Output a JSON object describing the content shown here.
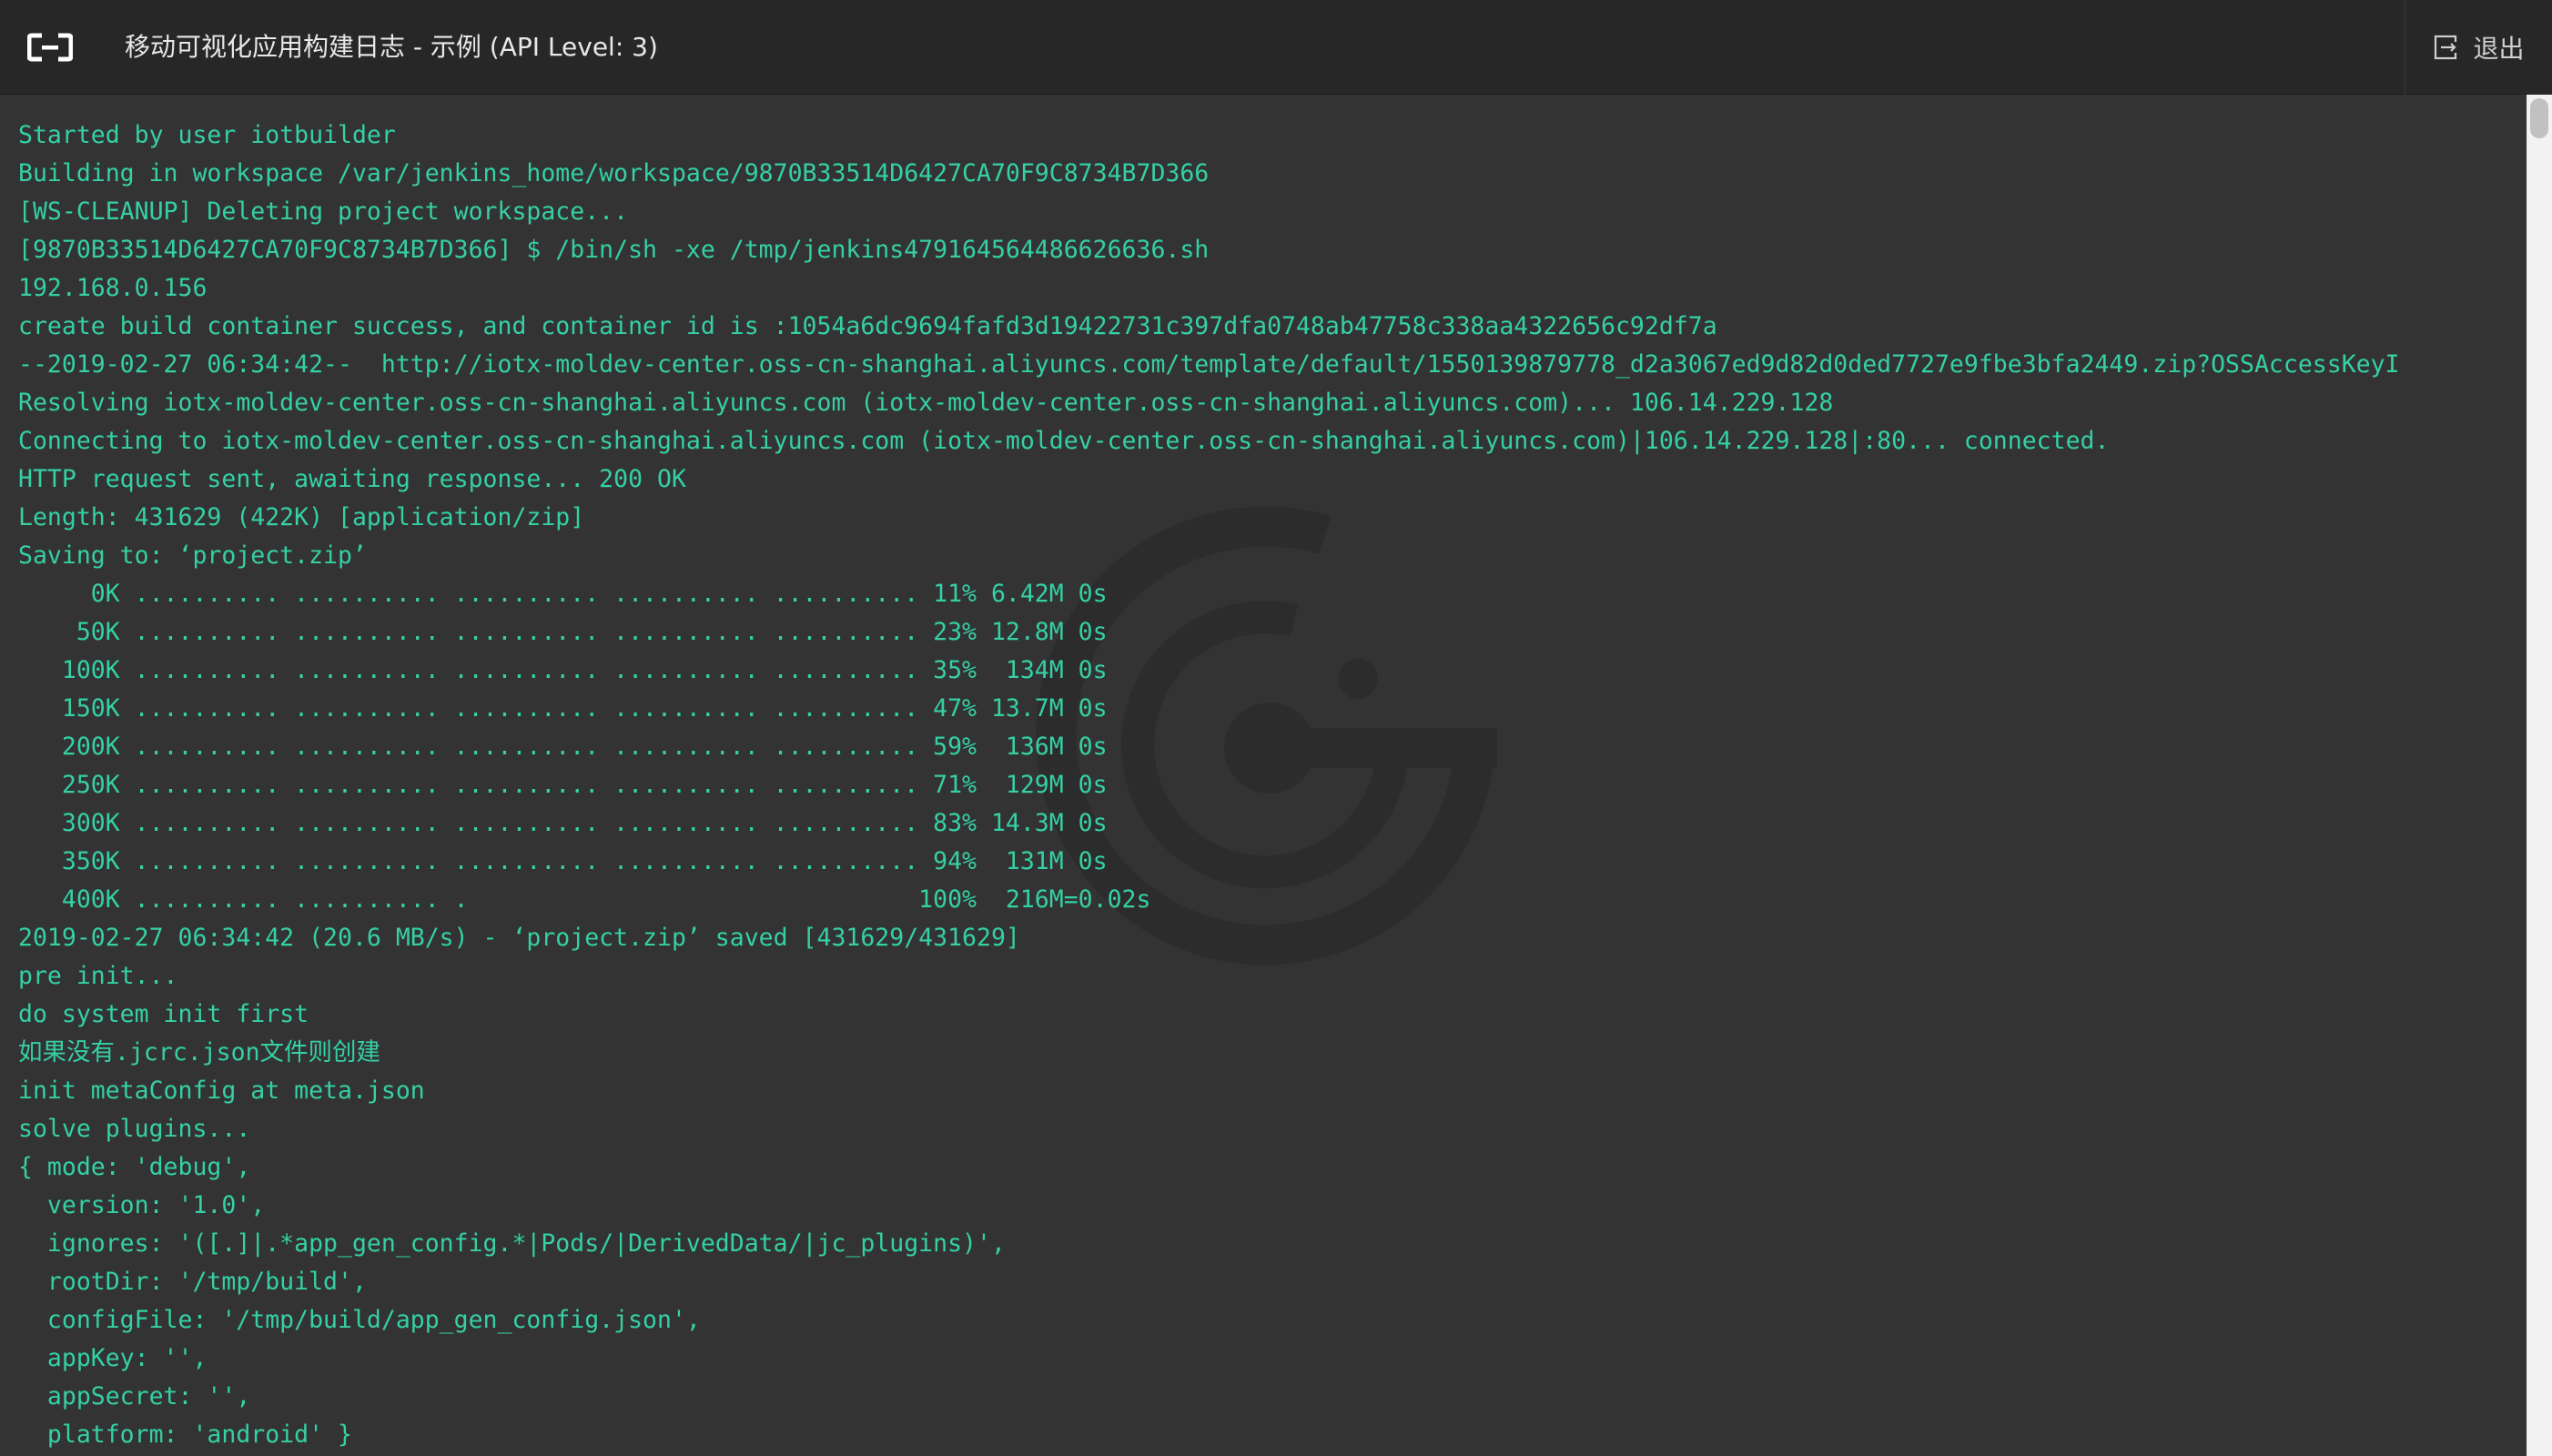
{
  "header": {
    "title": "移动可视化应用构建日志 - 示例 (API Level: 3)",
    "logo_icon": "aliyun-logo-icon",
    "exit_icon": "exit-icon",
    "exit_label": "退出"
  },
  "colors": {
    "header_bg": "#272727",
    "console_bg": "#333333",
    "log_text": "#35d0a4",
    "title_text": "#e8e8e8"
  },
  "watermark_icon": "g-logo-watermark-icon",
  "log_lines": [
    "Started by user iotbuilder",
    "Building in workspace /var/jenkins_home/workspace/9870B33514D6427CA70F9C8734B7D366",
    "[WS-CLEANUP] Deleting project workspace...",
    "[9870B33514D6427CA70F9C8734B7D366] $ /bin/sh -xe /tmp/jenkins479164564486626636.sh",
    "192.168.0.156",
    "create build container success, and container id is :1054a6dc9694fafd3d19422731c397dfa0748ab47758c338aa4322656c92df7a",
    "--2019-02-27 06:34:42--  http://iotx-moldev-center.oss-cn-shanghai.aliyuncs.com/template/default/1550139879778_d2a3067ed9d82d0ded7727e9fbe3bfa2449.zip?OSSAccessKeyI",
    "Resolving iotx-moldev-center.oss-cn-shanghai.aliyuncs.com (iotx-moldev-center.oss-cn-shanghai.aliyuncs.com)... 106.14.229.128",
    "Connecting to iotx-moldev-center.oss-cn-shanghai.aliyuncs.com (iotx-moldev-center.oss-cn-shanghai.aliyuncs.com)|106.14.229.128|:80... connected.",
    "HTTP request sent, awaiting response... 200 OK",
    "Length: 431629 (422K) [application/zip]",
    "Saving to: ‘project.zip’",
    "     0K .......... .......... .......... .......... .......... 11% 6.42M 0s",
    "    50K .......... .......... .......... .......... .......... 23% 12.8M 0s",
    "   100K .......... .......... .......... .......... .......... 35%  134M 0s",
    "   150K .......... .......... .......... .......... .......... 47% 13.7M 0s",
    "   200K .......... .......... .......... .......... .......... 59%  136M 0s",
    "   250K .......... .......... .......... .......... .......... 71%  129M 0s",
    "   300K .......... .......... .......... .......... .......... 83% 14.3M 0s",
    "   350K .......... .......... .......... .......... .......... 94%  131M 0s",
    "   400K .......... .......... .                               100%  216M=0.02s",
    "2019-02-27 06:34:42 (20.6 MB/s) - ‘project.zip’ saved [431629/431629]",
    "pre init...",
    "do system init first",
    "如果没有.jcrc.json文件则创建",
    "init metaConfig at meta.json",
    "solve plugins...",
    "{ mode: 'debug',",
    "  version: '1.0',",
    "  ignores: '([.]|.*app_gen_config.*|Pods/|DerivedData/|jc_plugins)',",
    "  rootDir: '/tmp/build',",
    "  configFile: '/tmp/build/app_gen_config.json',",
    "  appKey: '',",
    "  appSecret: '',",
    "  platform: 'android' }"
  ]
}
